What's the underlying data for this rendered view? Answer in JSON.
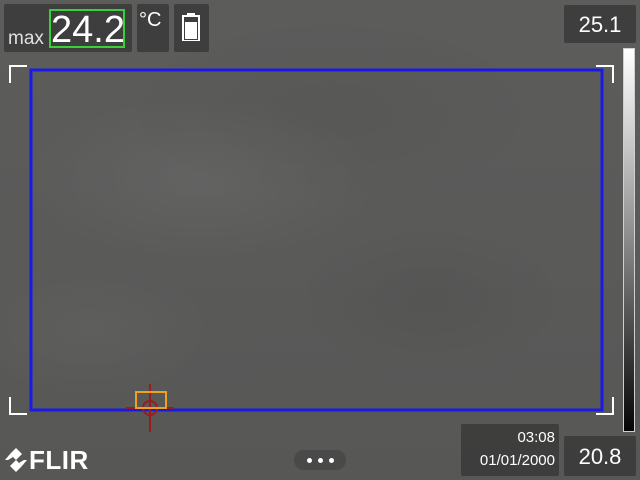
{
  "header": {
    "max_label": "max",
    "max_value": "24.2",
    "unit": "°C",
    "battery_icon": "battery-icon"
  },
  "scale": {
    "high": "25.1",
    "low": "20.8"
  },
  "status": {
    "time": "03:08",
    "date": "01/01/2000"
  },
  "brand": {
    "logo_text": "FLIR"
  },
  "colors": {
    "measurement_box": "#1a1ae6",
    "max_highlight": "#39d13a",
    "hotspot_marker": "#f0a020",
    "crosshair": "#9a1c1c"
  }
}
